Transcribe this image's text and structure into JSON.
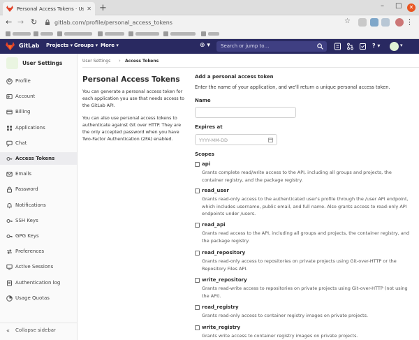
{
  "browser": {
    "tab_title": "Personal Access Tokens · User",
    "new_tab": "+",
    "url": "gitlab.com/profile/personal_access_tokens",
    "min": "–",
    "max": "□",
    "close": "✕"
  },
  "header": {
    "brand": "GitLab",
    "nav": [
      "Projects ▾",
      "Groups ▾",
      "More ▾"
    ],
    "plus": "⊕ ▾",
    "search_placeholder": "Search or jump to…",
    "help": "? ▾"
  },
  "sidebar": {
    "title": "User Settings",
    "items": [
      {
        "label": "Profile",
        "icon": "profile-icon"
      },
      {
        "label": "Account",
        "icon": "account-icon"
      },
      {
        "label": "Billing",
        "icon": "billing-icon"
      },
      {
        "label": "Applications",
        "icon": "applications-icon"
      },
      {
        "label": "Chat",
        "icon": "chat-icon"
      },
      {
        "label": "Access Tokens",
        "icon": "token-icon"
      },
      {
        "label": "Emails",
        "icon": "email-icon"
      },
      {
        "label": "Password",
        "icon": "lock-icon"
      },
      {
        "label": "Notifications",
        "icon": "bell-icon"
      },
      {
        "label": "SSH Keys",
        "icon": "key-icon"
      },
      {
        "label": "GPG Keys",
        "icon": "key-icon"
      },
      {
        "label": "Preferences",
        "icon": "preferences-icon"
      },
      {
        "label": "Active Sessions",
        "icon": "sessions-icon"
      },
      {
        "label": "Authentication log",
        "icon": "log-icon"
      },
      {
        "label": "Usage Quotas",
        "icon": "quota-icon"
      }
    ],
    "active_index": 5,
    "collapse_label": "Collapse sidebar",
    "collapse_icon": "«"
  },
  "breadcrumb": {
    "parent": "User Settings",
    "sep": "›",
    "current": "Access Tokens"
  },
  "main": {
    "title": "Personal Access Tokens",
    "desc1": "You can generate a personal access token for each application you use that needs access to the GitLab API.",
    "desc2": "You can also use personal access tokens to authenticate against Git over HTTP. They are the only accepted password when you have Two-Factor Authentication (2FA) enabled.",
    "form_title": "Add a personal access token",
    "form_help": "Enter the name of your application, and we'll return a unique personal access token.",
    "name_label": "Name",
    "expires_label": "Expires at",
    "expires_placeholder": "YYYY-MM-DD",
    "scopes_label": "Scopes",
    "scopes": [
      {
        "name": "api",
        "desc": "Grants complete read/write access to the API, including all groups and projects, the container registry, and the package registry."
      },
      {
        "name": "read_user",
        "desc": "Grants read-only access to the authenticated user's profile through the /user API endpoint, which includes username, public email, and full name. Also grants access to read-only API endpoints under /users."
      },
      {
        "name": "read_api",
        "desc": "Grants read access to the API, including all groups and projects, the container registry, and the package registry."
      },
      {
        "name": "read_repository",
        "desc": "Grants read-only access to repositories on private projects using Git-over-HTTP or the Repository Files API."
      },
      {
        "name": "write_repository",
        "desc": "Grants read-write access to repositories on private projects using Git-over-HTTP (not using the API)."
      },
      {
        "name": "read_registry",
        "desc": "Grants read-only access to container registry images on private projects."
      },
      {
        "name": "write_registry",
        "desc": "Grants write access to container registry images on private projects."
      }
    ]
  },
  "colors": {
    "header_bg": "#292961",
    "search_bg": "#3f3f82",
    "logo_orange": "#e24329",
    "close_btn": "#e95420"
  }
}
